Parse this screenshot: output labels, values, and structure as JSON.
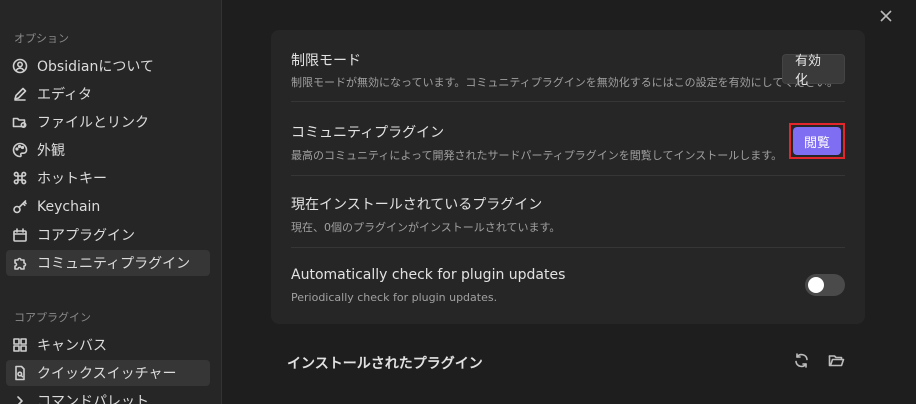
{
  "sidebar": {
    "options_heading": "オプション",
    "options_items": [
      {
        "label": "Obsidianについて",
        "icon": "person-circle-icon"
      },
      {
        "label": "エディタ",
        "icon": "pencil-icon"
      },
      {
        "label": "ファイルとリンク",
        "icon": "folder-icon"
      },
      {
        "label": "外観",
        "icon": "palette-icon"
      },
      {
        "label": "ホットキー",
        "icon": "command-icon"
      },
      {
        "label": "Keychain",
        "icon": "key-icon"
      },
      {
        "label": "コアプラグイン",
        "icon": "calendar-box-icon"
      },
      {
        "label": "コミュニティプラグイン",
        "icon": "puzzle-icon"
      }
    ],
    "core_heading": "コアプラグイン",
    "core_items": [
      {
        "label": "キャンバス",
        "icon": "grid-icon"
      },
      {
        "label": "クイックスイッチャー",
        "icon": "file-search-icon"
      },
      {
        "label": "コマンドパレット",
        "icon": "chevron-right-icon"
      }
    ]
  },
  "settings": {
    "restricted": {
      "name": "制限モード",
      "desc": "制限モードが無効になっています。コミュニティプラグインを無効化するにはこの設定を有効にしてください。",
      "button": "有効化"
    },
    "community": {
      "name": "コミュニティプラグイン",
      "desc": "最高のコミュニティによって開発されたサードパーティプラグインを閲覧してインストールします。",
      "button": "閲覧"
    },
    "installed": {
      "name": "現在インストールされているプラグイン",
      "desc": "現在、0個のプラグインがインストールされています。"
    },
    "autocheck": {
      "name": "Automatically check for plugin updates",
      "desc": "Periodically check for plugin updates.",
      "enabled": false
    }
  },
  "installed_section": {
    "title": "インストールされたプラグイン"
  },
  "colors": {
    "accent": "#7f6df2",
    "highlight_border": "#e3262b"
  }
}
